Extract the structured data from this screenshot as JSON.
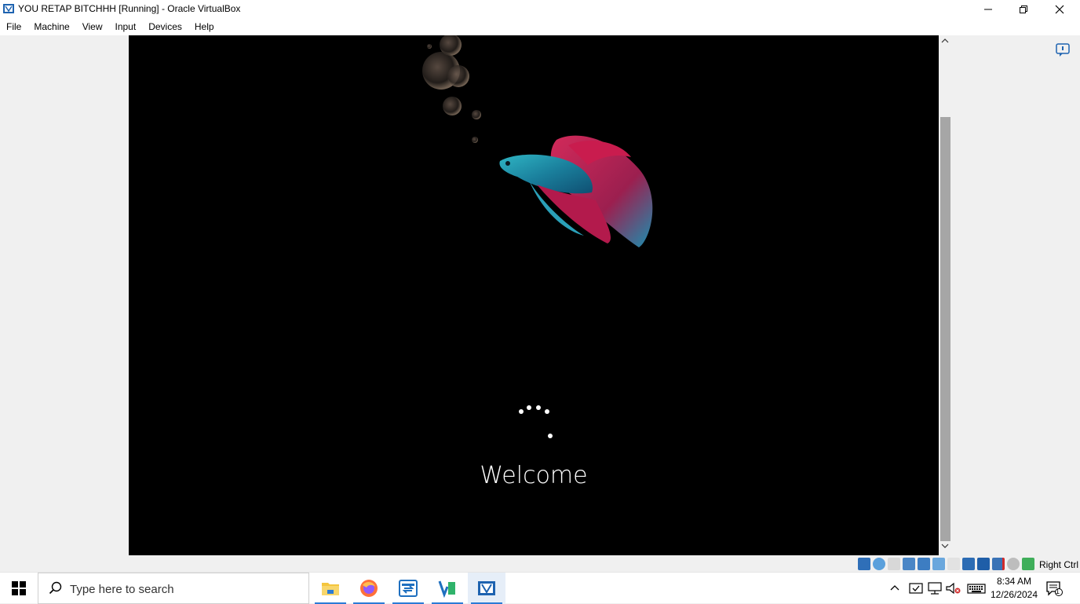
{
  "window": {
    "title": "YOU RETAP BITCHHH [Running] - Oracle VirtualBox",
    "icon": "virtualbox-icon"
  },
  "menu": {
    "items": [
      "File",
      "Machine",
      "View",
      "Input",
      "Devices",
      "Help"
    ]
  },
  "guest": {
    "welcome_text": "Welcome",
    "background_image": "betta-fish-wallpaper"
  },
  "vbox_status": {
    "icons": [
      "hard-disk-icon",
      "optical-drive-icon",
      "floppy-icon",
      "audio-icon",
      "network-icon",
      "usb-icon",
      "shared-folders-icon",
      "display-icon",
      "video-capture-icon",
      "recording-icon",
      "cpu-icon",
      "mouse-integration-icon",
      "keyboard-icon"
    ],
    "host_key": "Right Ctrl"
  },
  "taskbar": {
    "search_placeholder": "Type here to search",
    "apps": [
      {
        "name": "file-explorer-icon",
        "running": true
      },
      {
        "name": "firefox-icon",
        "running": true
      },
      {
        "name": "remote-desktop-icon",
        "running": true
      },
      {
        "name": "vs-app-icon",
        "running": true
      },
      {
        "name": "virtualbox-icon",
        "running": true,
        "active": true
      }
    ],
    "clock_time": "8:34 AM",
    "clock_date": "12/26/2024",
    "notification_count": "1"
  },
  "colors": {
    "vm_background": "#000000",
    "taskbar_accent": "#2b7bd6",
    "vbox_blue": "#1e63b0"
  }
}
